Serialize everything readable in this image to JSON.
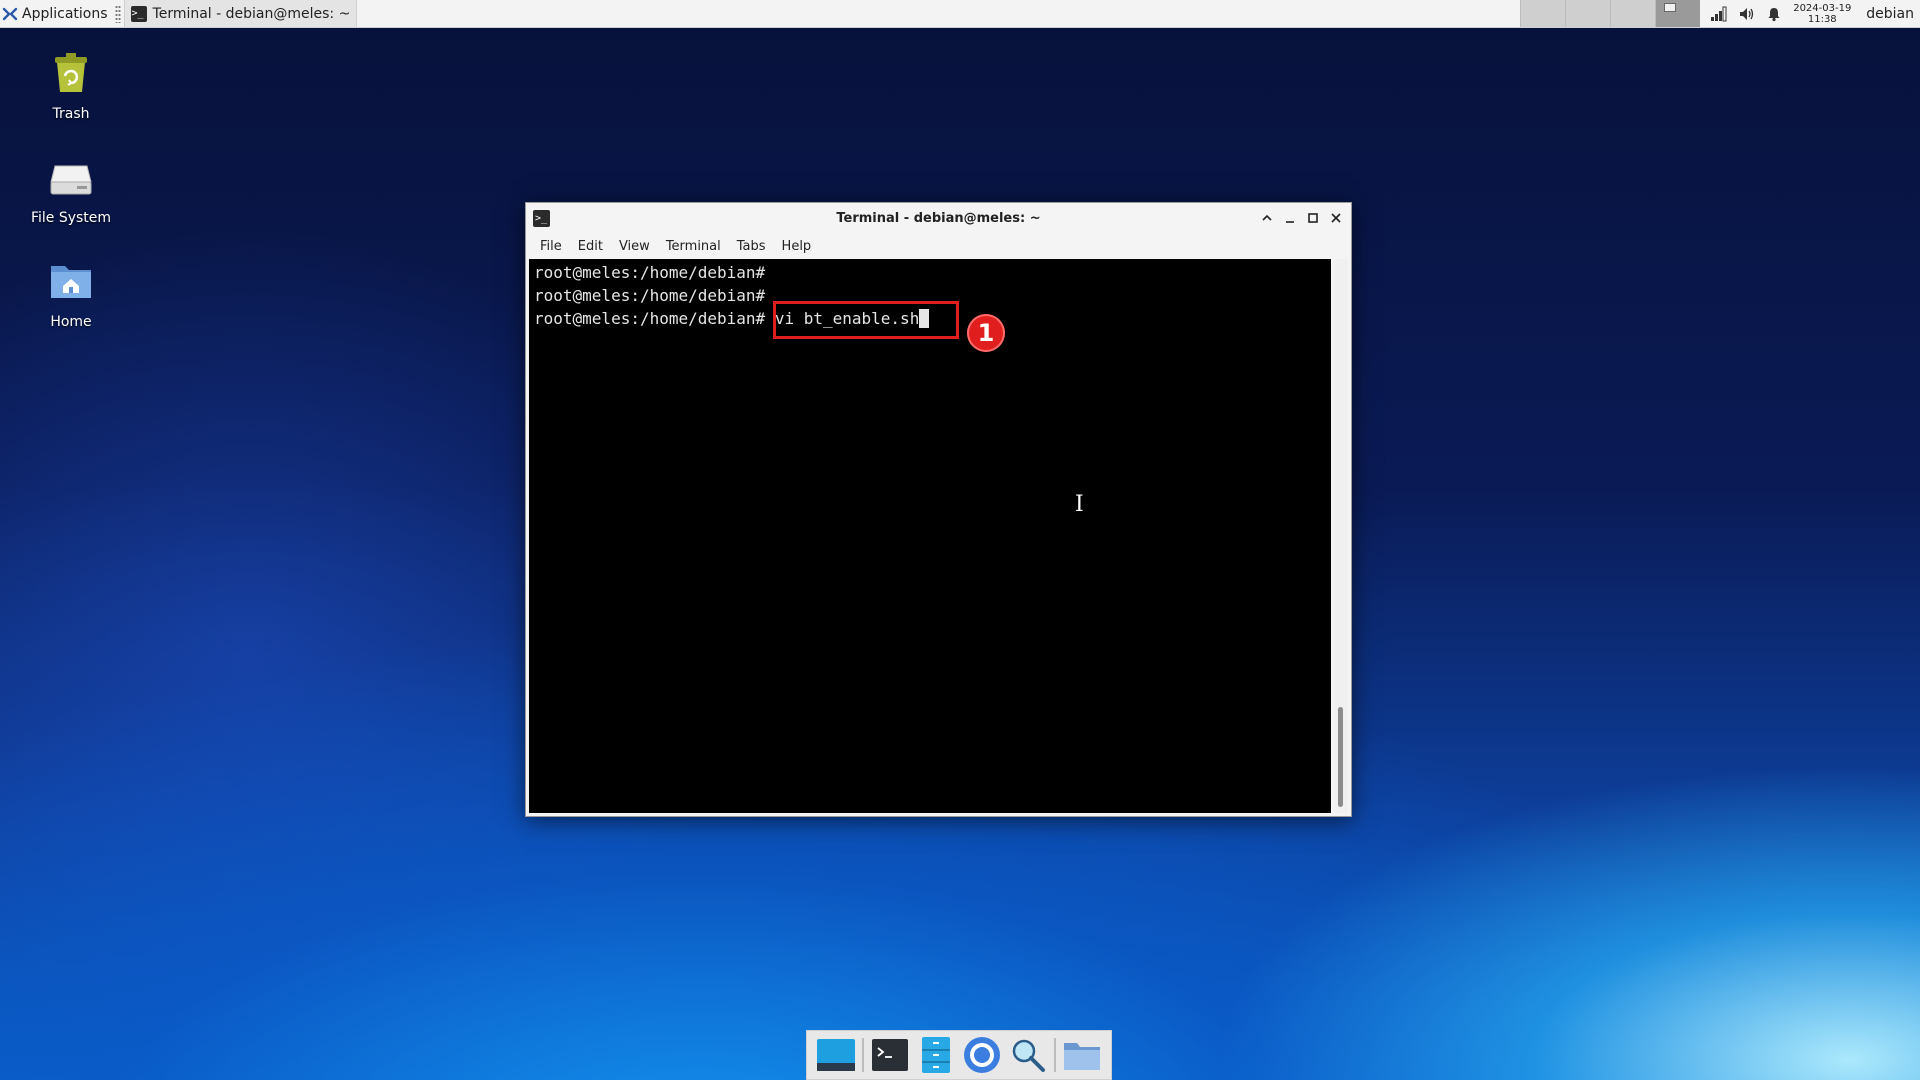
{
  "top_panel": {
    "applications_label": "Applications",
    "task_title": "Terminal - debian@meles: ~",
    "clock_date": "2024-03-19",
    "clock_time": "11:38",
    "user": "debian"
  },
  "desktop_icons": [
    {
      "label": "Trash",
      "icon": "trash-icon"
    },
    {
      "label": "File System",
      "icon": "drive-icon"
    },
    {
      "label": "Home",
      "icon": "home-folder-icon"
    }
  ],
  "window": {
    "title": "Terminal - debian@meles: ~",
    "menu": [
      "File",
      "Edit",
      "View",
      "Terminal",
      "Tabs",
      "Help"
    ],
    "lines": [
      "root@meles:/home/debian#",
      "root@meles:/home/debian#"
    ],
    "prompt": "root@meles:/home/debian#",
    "command": "vi bt_enable.sh"
  },
  "annotation": {
    "step_number": "1",
    "color": "#e01e1e"
  },
  "dock": {
    "items": [
      "show-desktop-icon",
      "terminal-icon",
      "file-manager-icon",
      "web-browser-icon",
      "app-finder-icon",
      "folder-icon"
    ]
  }
}
